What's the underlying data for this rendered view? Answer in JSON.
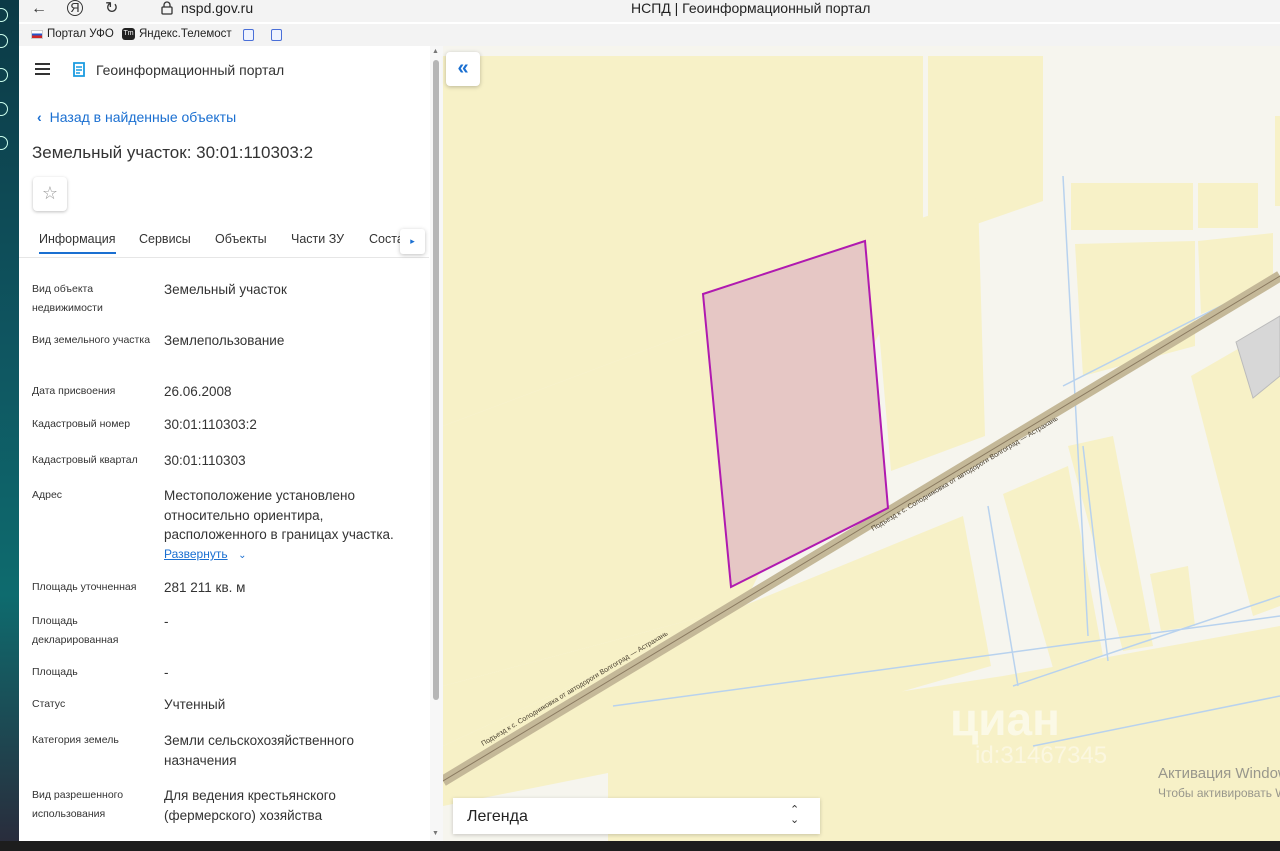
{
  "browser": {
    "url": "nspd.gov.ru",
    "window_title": "НСПД | Геоинформационный портал",
    "bookmarks": [
      "Портал УФО",
      "Яндекс.Телемост"
    ],
    "yandex_icon": "Я",
    "telemost_icon": "Tm"
  },
  "header": {
    "portal_name": "Геоинформационный портал"
  },
  "panel": {
    "back_link": "Назад в найденные объекты",
    "title": "Земельный участок: 30:01:110303:2",
    "favorite_icon": "☆",
    "tabs": [
      "Информация",
      "Сервисы",
      "Объекты",
      "Части ЗУ",
      "Соста"
    ],
    "tab_next_icon": "▸",
    "fields": [
      {
        "label": "Вид объекта недвижимости",
        "value": "Земельный участок"
      },
      {
        "label": "Вид земельного участка",
        "value": "Землепользование"
      },
      {
        "label": "Дата присвоения",
        "value": "26.06.2008"
      },
      {
        "label": "Кадастровый номер",
        "value": "30:01:110303:2"
      },
      {
        "label": "Кадастровый квартал",
        "value": "30:01:110303"
      },
      {
        "label": "Адрес",
        "value": "Местоположение установлено относительно ориентира, расположенного в границах участка."
      },
      {
        "label": "Площадь уточненная",
        "value": "281 211 кв. м"
      },
      {
        "label": "Площадь декларированная",
        "value": "-"
      },
      {
        "label": "Площадь",
        "value": "-"
      },
      {
        "label": "Статус",
        "value": "Учтенный"
      },
      {
        "label": "Категория земель",
        "value": "Земли сельскохозяйственного назначения"
      },
      {
        "label": "Вид разрешенного использования",
        "value": "Для ведения крестьянского (фермерского) хозяйства"
      }
    ],
    "expand_link": "Развернуть"
  },
  "map": {
    "collapse_icon": "«",
    "road_label": "Подъезд к с. Солодниковка от автодороги Волгоград — Астрахань",
    "legend_label": "Легенда",
    "watermark": "циан",
    "watermark_sub": "id:31467345",
    "activation_title": "Активация Windows",
    "activation_sub": "Чтобы активировать Windows"
  },
  "colors": {
    "accent": "#1a6fd1",
    "parcel_fill": "#e8c4c4",
    "parcel_stroke": "#b01ab0",
    "land_fill": "#f7f1c7",
    "road": "#b8a98a"
  }
}
